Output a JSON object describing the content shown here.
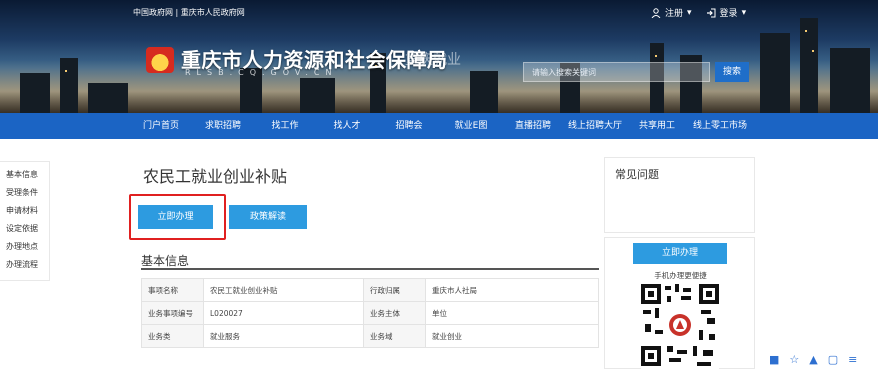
{
  "header": {
    "top_links": "中国政府网 | 重庆市人民政府网",
    "register": "注册",
    "login": "登录",
    "site_title": "重庆市人力资源和社会保障局",
    "site_subtitle": "RLSB.CQ.GOV.CN",
    "brand2": "重庆就业",
    "search_placeholder": "请输入搜索关键词",
    "search_button": "搜索"
  },
  "nav": [
    "门户首页",
    "求职招聘",
    "找工作",
    "找人才",
    "招聘会",
    "就业E图",
    "直播招聘",
    "线上招聘大厅",
    "共享用工",
    "线上零工市场"
  ],
  "sidebar": [
    "基本信息",
    "受理条件",
    "申请材料",
    "设定依据",
    "办理地点",
    "办理流程"
  ],
  "main": {
    "title": "农民工就业创业补贴",
    "apply_button": "立即办理",
    "policy_button": "政策解读",
    "section_title": "基本信息",
    "table": [
      [
        "事项名称",
        "农民工就业创业补贴",
        "行政归属",
        "重庆市人社局"
      ],
      [
        "业务事项编号",
        "L020027",
        "业务主体",
        "单位"
      ],
      [
        "业务类",
        "就业服务",
        "业务域",
        "就业创业"
      ]
    ]
  },
  "right": {
    "faq_title": "常见问题",
    "apply_button": "立即办理",
    "qr_caption": "手机办理更便捷"
  },
  "colors": {
    "nav_blue": "#1b64c4",
    "button_blue": "#2d9be0",
    "highlight_red": "#e02020"
  }
}
